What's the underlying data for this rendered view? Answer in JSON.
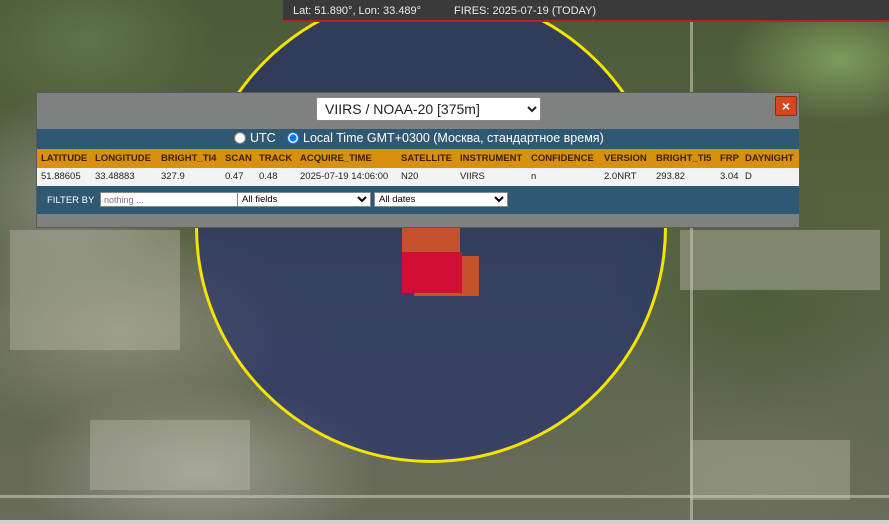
{
  "status_bar": {
    "coords": "Lat: 51.890°, Lon: 33.489°",
    "fires": "FIRES: 2025-07-19 (TODAY)",
    "border_color": "#c01f1f"
  },
  "map": {
    "circle_color": "#f4e300",
    "fire_colors": [
      "#c4532b",
      "#cf0f34"
    ]
  },
  "popup": {
    "satellite_selected": "VIIRS / NOAA-20 [375m]",
    "close_icon": "×",
    "time_options": {
      "utc_label": "UTC",
      "local_label": "Local Time GMT+0300 (Москва, стандартное время)",
      "selected": "local"
    },
    "columns": [
      "LATITUDE",
      "LONGITUDE",
      "BRIGHT_TI4",
      "SCAN",
      "TRACK",
      "ACQUIRE_TIME",
      "SATELLITE",
      "INSTRUMENT",
      "CONFIDENCE",
      "VERSION",
      "BRIGHT_TI5",
      "FRP",
      "DAYNIGHT"
    ],
    "row": [
      "51.88605",
      "33.48883",
      "327.9",
      "0.47",
      "0.48",
      "2025-07-19 14:06:00",
      "N20",
      "VIIRS",
      "n",
      "2.0NRT",
      "293.82",
      "3.04",
      "D"
    ],
    "filter": {
      "label": "FILTER BY",
      "placeholder": "nothing ...",
      "field_selected": "All fields",
      "date_selected": "All dates"
    },
    "header_color": "#d9900f",
    "bar_color": "#2f5873"
  }
}
